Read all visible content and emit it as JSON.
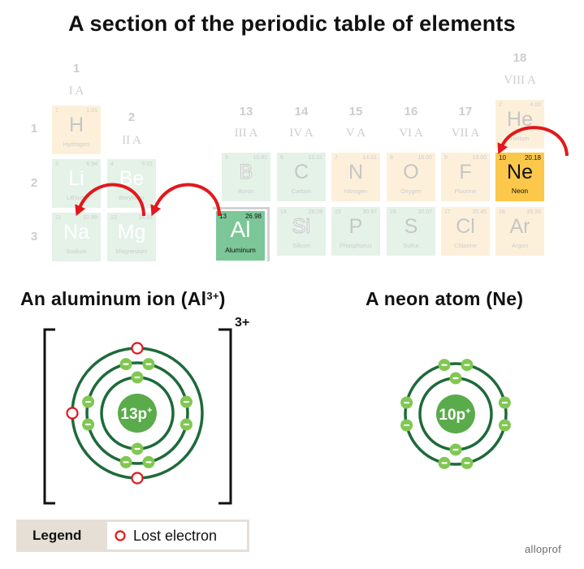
{
  "title": "A section of the periodic table of elements",
  "colors": {
    "arrow": "#e3171c",
    "gas_tile": "#fdf0da",
    "solid_tile": "#e4f2e8",
    "al_highlight": "#7bc797",
    "ne_highlight": "#fcc84b",
    "orbit": "#1e6a3a",
    "electron": "#80c852",
    "nucleus": "#5aab4a",
    "lost_electron": "#e3171c",
    "legend_bg": "#e6dfd6"
  },
  "periodic_table": {
    "groups": [
      {
        "number": "1",
        "roman": "I A"
      },
      {
        "number": "2",
        "roman": "II A"
      },
      {
        "number": "13",
        "roman": "III A"
      },
      {
        "number": "14",
        "roman": "IV A"
      },
      {
        "number": "15",
        "roman": "V A"
      },
      {
        "number": "16",
        "roman": "VI A"
      },
      {
        "number": "17",
        "roman": "VII A"
      },
      {
        "number": "18",
        "roman": "VIII A"
      }
    ],
    "periods": [
      "1",
      "2",
      "3"
    ],
    "elements": [
      {
        "number": "1",
        "mass": "1.01",
        "symbol": "H",
        "name": "Hydrogen",
        "group": 1,
        "period": 1,
        "state": "gas",
        "type": "nonmetal"
      },
      {
        "number": "2",
        "mass": "4.00",
        "symbol": "He",
        "name": "Helium",
        "group": 18,
        "period": 1,
        "state": "gas",
        "type": "nonmetal"
      },
      {
        "number": "3",
        "mass": "6.94",
        "symbol": "Li",
        "name": "Lithium",
        "group": 1,
        "period": 2,
        "state": "solid",
        "type": "metal"
      },
      {
        "number": "4",
        "mass": "9.01",
        "symbol": "Be",
        "name": "Beryllium",
        "group": 2,
        "period": 2,
        "state": "solid",
        "type": "metal"
      },
      {
        "number": "5",
        "mass": "10.81",
        "symbol": "B",
        "name": "Boron",
        "group": 13,
        "period": 2,
        "state": "solid",
        "type": "metalloid"
      },
      {
        "number": "6",
        "mass": "12.01",
        "symbol": "C",
        "name": "Carbon",
        "group": 14,
        "period": 2,
        "state": "solid",
        "type": "nonmetal"
      },
      {
        "number": "7",
        "mass": "14.01",
        "symbol": "N",
        "name": "Nitrogen",
        "group": 15,
        "period": 2,
        "state": "gas",
        "type": "nonmetal"
      },
      {
        "number": "8",
        "mass": "16.00",
        "symbol": "O",
        "name": "Oxygen",
        "group": 16,
        "period": 2,
        "state": "gas",
        "type": "nonmetal"
      },
      {
        "number": "9",
        "mass": "19.00",
        "symbol": "F",
        "name": "Fluorine",
        "group": 17,
        "period": 2,
        "state": "gas",
        "type": "nonmetal"
      },
      {
        "number": "10",
        "mass": "20.18",
        "symbol": "Ne",
        "name": "Neon",
        "group": 18,
        "period": 2,
        "state": "gas",
        "type": "nonmetal",
        "highlighted": true
      },
      {
        "number": "11",
        "mass": "22.99",
        "symbol": "Na",
        "name": "Sodium",
        "group": 1,
        "period": 3,
        "state": "solid",
        "type": "metal"
      },
      {
        "number": "12",
        "mass": "24.31",
        "symbol": "Mg",
        "name": "Magnesium",
        "group": 2,
        "period": 3,
        "state": "solid",
        "type": "metal"
      },
      {
        "number": "13",
        "mass": "26.98",
        "symbol": "Al",
        "name": "Aluminum",
        "group": 13,
        "period": 3,
        "state": "solid",
        "type": "metal",
        "highlighted": true,
        "lifted_out": true
      },
      {
        "number": "14",
        "mass": "28.09",
        "symbol": "Si",
        "name": "Silicon",
        "group": 14,
        "period": 3,
        "state": "solid",
        "type": "metalloid"
      },
      {
        "number": "15",
        "mass": "30.97",
        "symbol": "P",
        "name": "Phosphorus",
        "group": 15,
        "period": 3,
        "state": "solid",
        "type": "nonmetal"
      },
      {
        "number": "16",
        "mass": "32.07",
        "symbol": "S",
        "name": "Sulfur",
        "group": 16,
        "period": 3,
        "state": "solid",
        "type": "nonmetal"
      },
      {
        "number": "17",
        "mass": "35.45",
        "symbol": "Cl",
        "name": "Chlorine",
        "group": 17,
        "period": 3,
        "state": "gas",
        "type": "nonmetal"
      },
      {
        "number": "18",
        "mass": "39.95",
        "symbol": "Ar",
        "name": "Argon",
        "group": 18,
        "period": 3,
        "state": "gas",
        "type": "nonmetal"
      }
    ],
    "arrows": [
      {
        "from": "Mg",
        "to": "Na"
      },
      {
        "from": "Al",
        "to": "Mg"
      },
      {
        "to": "Ne"
      }
    ]
  },
  "aluminum_ion": {
    "heading_text": "An aluminum ion (Al",
    "heading_sup": "3+",
    "heading_close": ")",
    "charge": "3+",
    "nucleus": {
      "count": "13",
      "particle": "p",
      "sign": "+"
    },
    "shells": [
      {
        "electrons": 2,
        "lost": 0
      },
      {
        "electrons": 8,
        "lost": 0
      },
      {
        "electrons": 0,
        "lost": 3
      }
    ]
  },
  "neon_atom": {
    "heading": "A neon atom (Ne)",
    "nucleus": {
      "count": "10",
      "particle": "p",
      "sign": "+"
    },
    "shells": [
      {
        "electrons": 2,
        "lost": 0
      },
      {
        "electrons": 8,
        "lost": 0
      }
    ]
  },
  "legend": {
    "title": "Legend",
    "items": [
      {
        "icon": "lost-electron-icon",
        "label": "Lost electron"
      }
    ]
  },
  "logo": "alloprof"
}
